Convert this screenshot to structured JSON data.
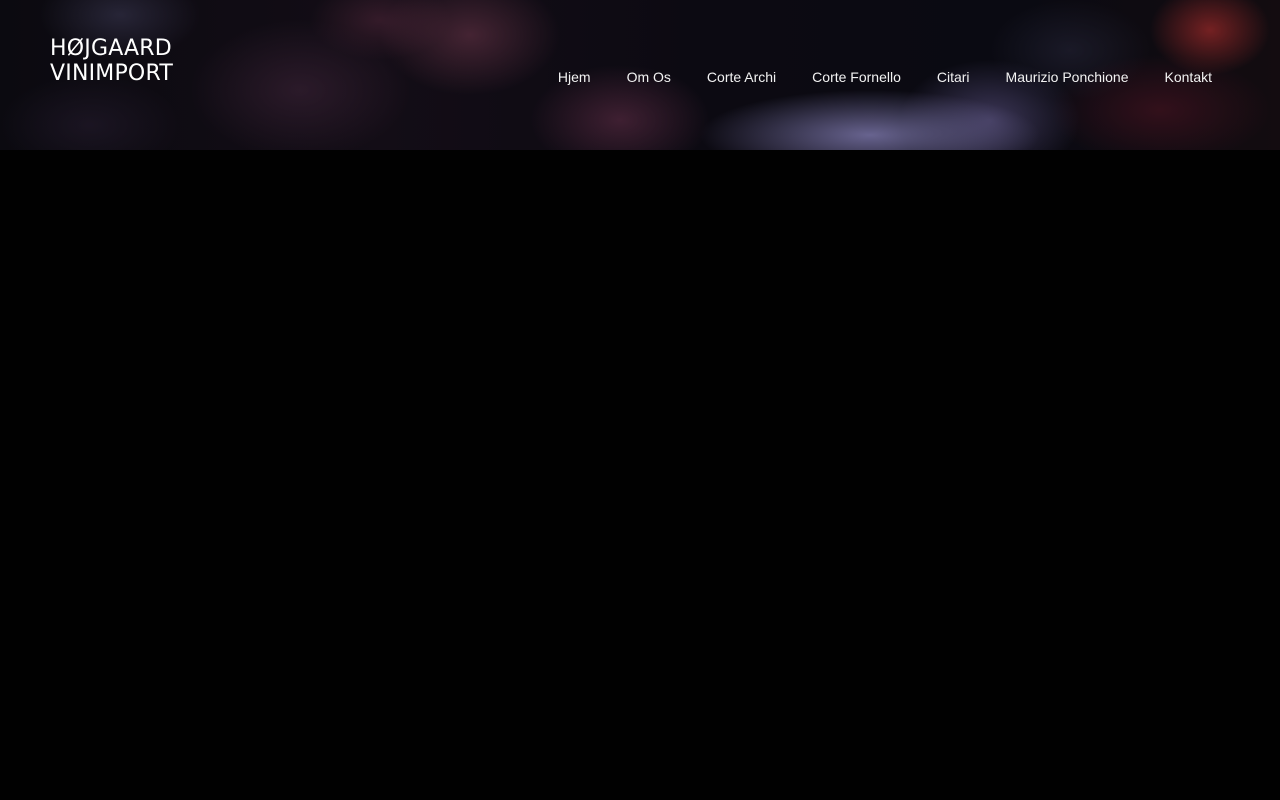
{
  "brand": {
    "line1": "HØJGAARD",
    "line2": "VINIMPORT"
  },
  "nav": {
    "items": [
      {
        "label": "Hjem"
      },
      {
        "label": "Om Os"
      },
      {
        "label": "Corte Archi"
      },
      {
        "label": "Corte Fornello"
      },
      {
        "label": "Citari"
      },
      {
        "label": "Maurizio Ponchione"
      },
      {
        "label": "Kontakt"
      }
    ]
  },
  "colors": {
    "page_background": "#010101",
    "nav_text": "#f2f2f2",
    "brand_text": "#ffffff"
  }
}
